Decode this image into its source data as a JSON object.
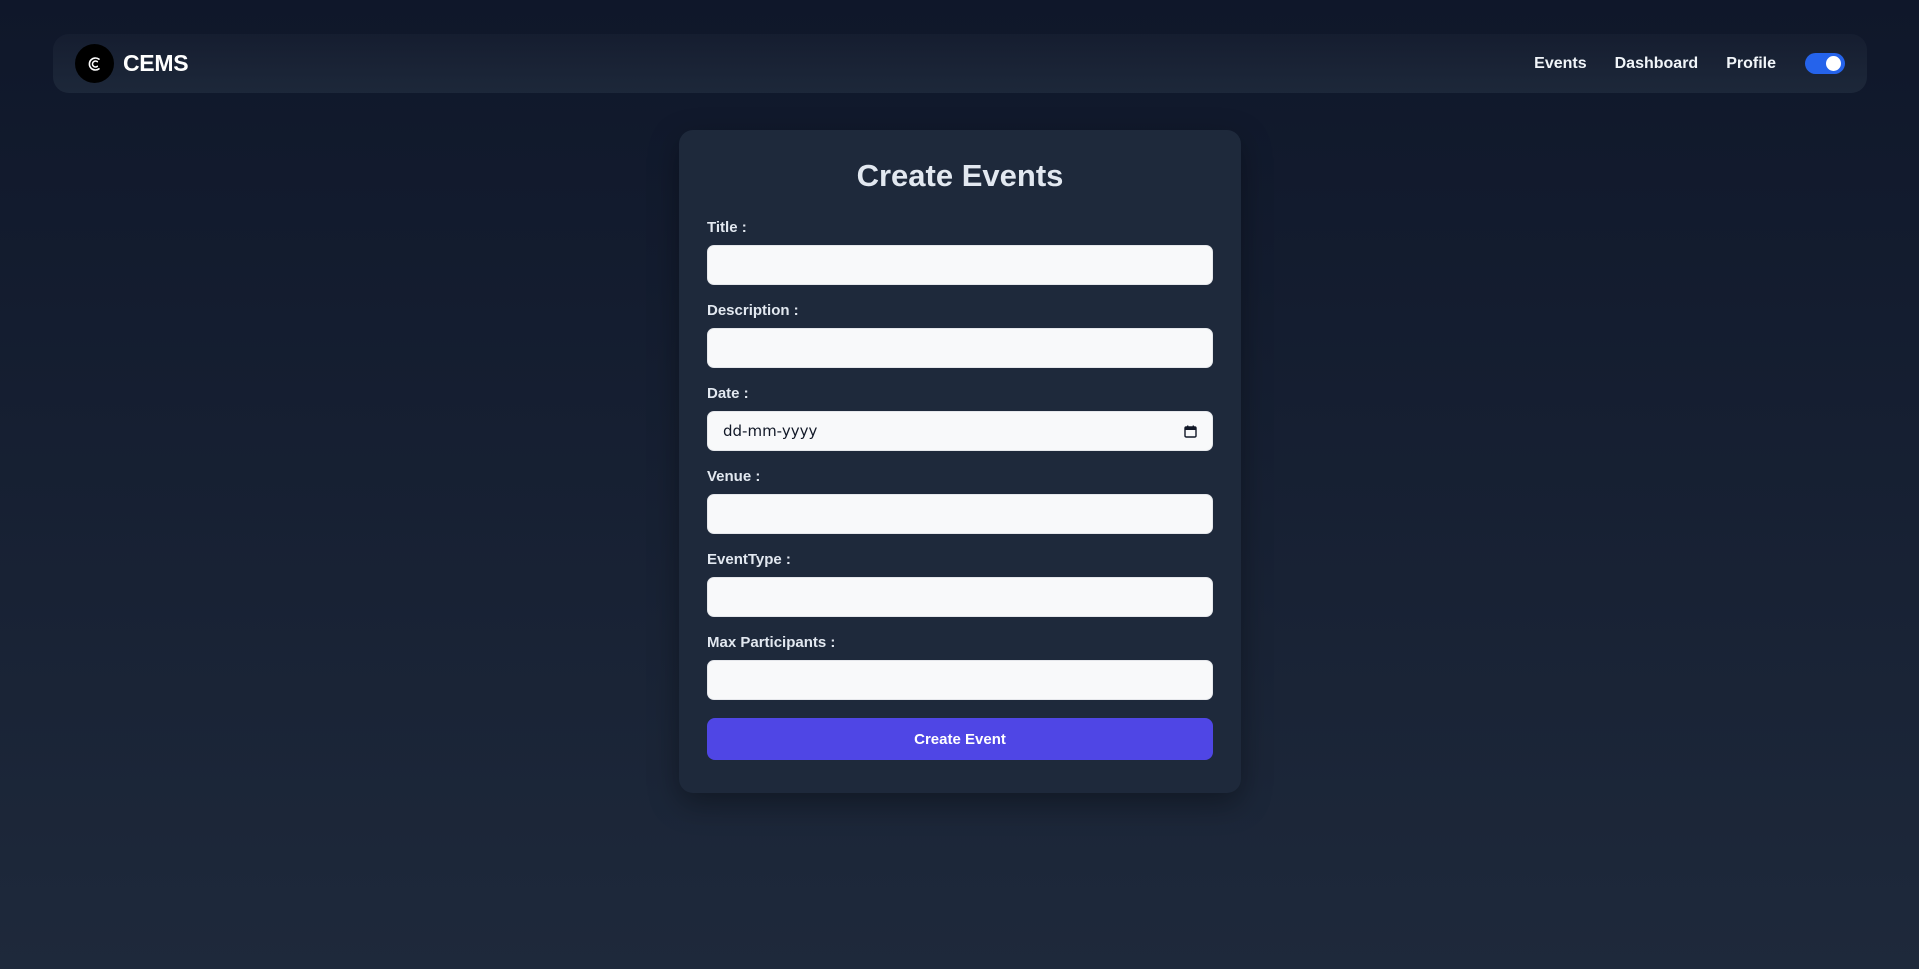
{
  "navbar": {
    "brand": "CEMS",
    "logo_icon": "cems-logo-icon",
    "links": [
      {
        "label": "Events"
      },
      {
        "label": "Dashboard"
      },
      {
        "label": "Profile"
      }
    ],
    "theme_toggle": {
      "state": "on",
      "color": "#2563eb"
    }
  },
  "form": {
    "title": "Create Events",
    "fields": [
      {
        "label": "Title :",
        "value": ""
      },
      {
        "label": "Description :",
        "value": ""
      },
      {
        "label": "Date :",
        "value": "dd-mm-yyyy",
        "icon": "calendar-icon"
      },
      {
        "label": "Venue :",
        "value": ""
      },
      {
        "label": "EventType :",
        "value": ""
      },
      {
        "label": "Max Participants :",
        "value": ""
      }
    ],
    "submit_label": "Create Event",
    "submit_color": "#4f46e5"
  }
}
